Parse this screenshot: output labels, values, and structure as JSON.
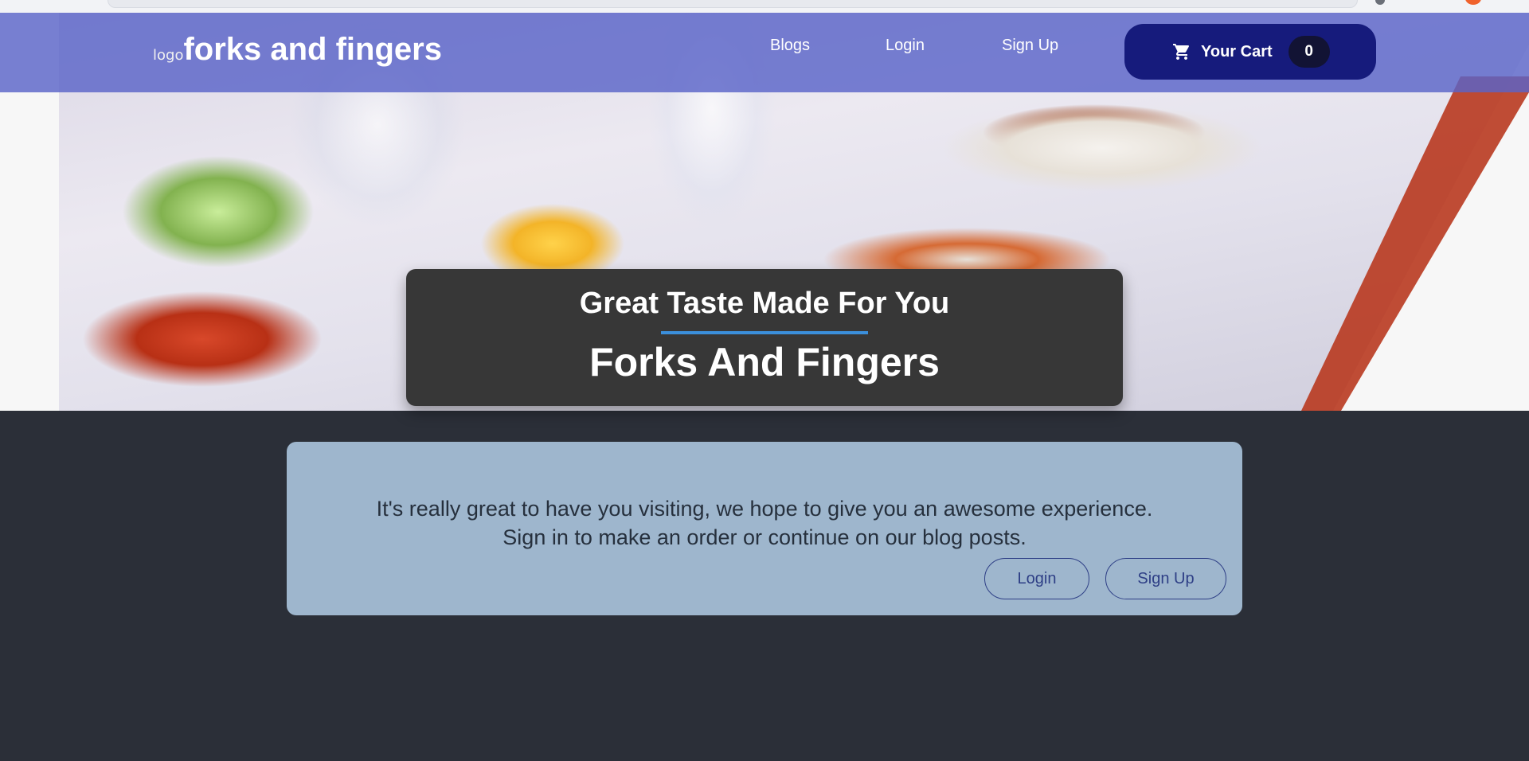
{
  "header": {
    "logo_alt": "logo",
    "brand_name": "forks and fingers",
    "nav": {
      "blogs": "Blogs",
      "login": "Login",
      "signup": "Sign Up"
    },
    "cart": {
      "label": "Your Cart",
      "count": "0",
      "icon": "cart-icon"
    }
  },
  "hero": {
    "tagline": "Great Taste Made For You",
    "title": "Forks And Fingers"
  },
  "welcome": {
    "line1": "It's really great to have you visiting, we hope to give you an awesome experience.",
    "line2": "Sign in to make an order or continue on our blog posts.",
    "login_button": "Login",
    "signup_button": "Sign Up"
  },
  "colors": {
    "navbar": "#5a64c8",
    "cart_button": "#161b7c",
    "caption_box": "#373737",
    "caption_underline": "#3b8fdb",
    "page_background": "#2b2f38",
    "welcome_card": "#9eb6cd",
    "card_button_border": "#2e3f86"
  }
}
